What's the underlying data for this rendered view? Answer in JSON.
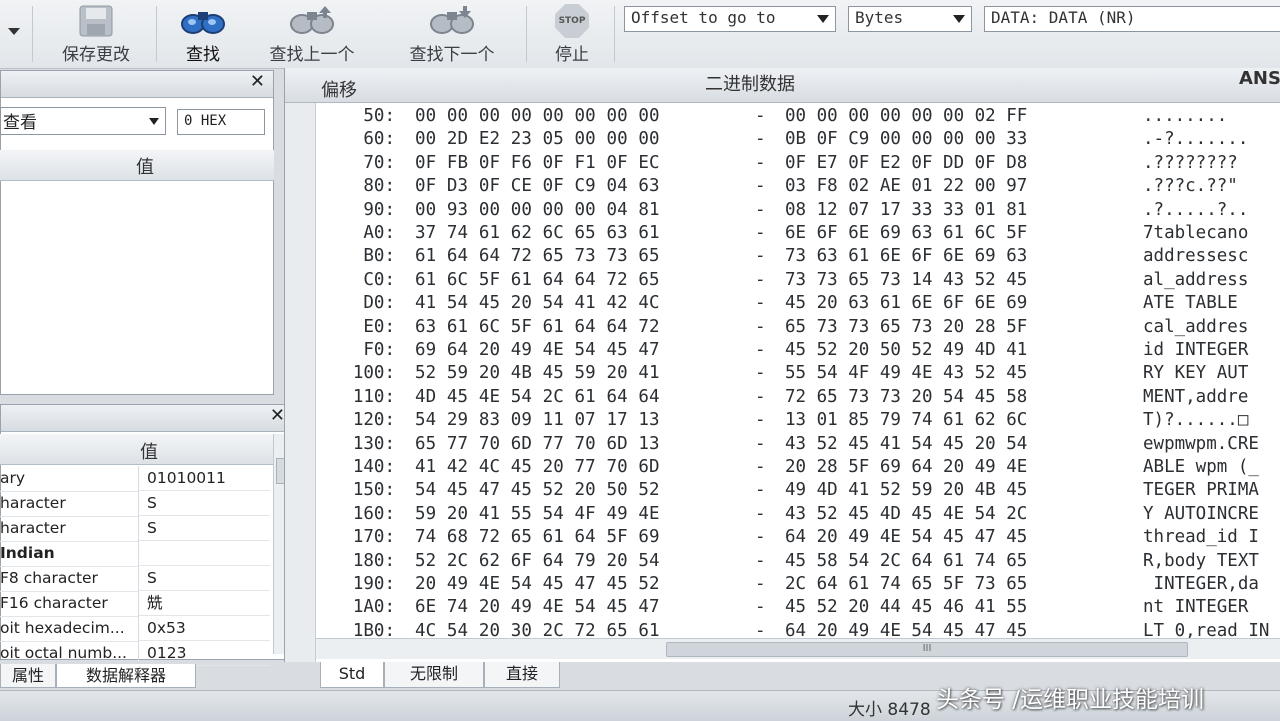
{
  "toolbar": {
    "save": "保存更改",
    "find": "查找",
    "find_prev": "查找上一个",
    "find_next": "查找下一个",
    "stop": "停止",
    "stop_icon_text": "STOP",
    "offset_combo": "Offset to go to",
    "unit_combo": "Bytes",
    "data_field": "DATA: DATA (NR)"
  },
  "left_top": {
    "view_select": "查看",
    "hex_field": "0 HEX",
    "value_header": "值"
  },
  "left_bottom": {
    "value_header": "值",
    "rows": [
      {
        "name": "ary",
        "value": "01010011"
      },
      {
        "name": "haracter",
        "value": "S"
      },
      {
        "name": "haracter",
        "value": "S"
      },
      {
        "name": "Indian",
        "value": ""
      },
      {
        "name": "F8 character",
        "value": "S"
      },
      {
        "name": "F16 character",
        "value": "兟"
      },
      {
        "name": "oit hexadecim...",
        "value": "0x53"
      },
      {
        "name": "oit octal numb...",
        "value": "0123"
      }
    ],
    "tabs": [
      "属性",
      "数据解释器"
    ]
  },
  "hex_view": {
    "offset_header": "偏移",
    "data_header": "二进制数据",
    "ascii_header": "ANS",
    "rows": [
      {
        "off": "50:",
        "b1": "00 00 00 00 00 00 00 00",
        "b2": "00 00 00 00 00 00 02 FF",
        "asc": "........"
      },
      {
        "off": "60:",
        "b1": "00 2D E2 23 05 00 00 00",
        "b2": "0B 0F C9 00 00 00 00 33",
        "asc": ".-?......."
      },
      {
        "off": "70:",
        "b1": "0F FB 0F F6 0F F1 0F EC",
        "b2": "0F E7 0F E2 0F DD 0F D8",
        "asc": ".????????"
      },
      {
        "off": "80:",
        "b1": "0F D3 0F CE 0F C9 04 63",
        "b2": "03 F8 02 AE 01 22 00 97",
        "asc": ".???c.??\""
      },
      {
        "off": "90:",
        "b1": "00 93 00 00 00 00 04 81",
        "b2": "08 12 07 17 33 33 01 81",
        "asc": ".?.....?.."
      },
      {
        "off": "A0:",
        "b1": "37 74 61 62 6C 65 63 61",
        "b2": "6E 6F 6E 69 63 61 6C 5F",
        "asc": "7tablecano"
      },
      {
        "off": "B0:",
        "b1": "61 64 64 72 65 73 73 65",
        "b2": "73 63 61 6E 6F 6E 69 63",
        "asc": "addressesc"
      },
      {
        "off": "C0:",
        "b1": "61 6C 5F 61 64 64 72 65",
        "b2": "73 73 65 73 14 43 52 45",
        "asc": "al_address"
      },
      {
        "off": "D0:",
        "b1": "41 54 45 20 54 41 42 4C",
        "b2": "45 20 63 61 6E 6F 6E 69",
        "asc": "ATE TABLE "
      },
      {
        "off": "E0:",
        "b1": "63 61 6C 5F 61 64 64 72",
        "b2": "65 73 73 65 73 20 28 5F",
        "asc": "cal_addres"
      },
      {
        "off": "F0:",
        "b1": "69 64 20 49 4E 54 45 47",
        "b2": "45 52 20 50 52 49 4D 41",
        "asc": "id INTEGER"
      },
      {
        "off": "100:",
        "b1": "52 59 20 4B 45 59 20 41",
        "b2": "55 54 4F 49 4E 43 52 45",
        "asc": "RY KEY AUT"
      },
      {
        "off": "110:",
        "b1": "4D 45 4E 54 2C 61 64 64",
        "b2": "72 65 73 73 20 54 45 58",
        "asc": "MENT,addre"
      },
      {
        "off": "120:",
        "b1": "54 29 83 09 11 07 17 13",
        "b2": "13 01 85 79 74 61 62 6C",
        "asc": "T)?......□"
      },
      {
        "off": "130:",
        "b1": "65 77 70 6D 77 70 6D 13",
        "b2": "43 52 45 41 54 45 20 54",
        "asc": "ewpmwpm.CRE"
      },
      {
        "off": "140:",
        "b1": "41 42 4C 45 20 77 70 6D",
        "b2": "20 28 5F 69 64 20 49 4E",
        "asc": "ABLE wpm (_"
      },
      {
        "off": "150:",
        "b1": "54 45 47 45 52 20 50 52",
        "b2": "49 4D 41 52 59 20 4B 45",
        "asc": "TEGER PRIMA"
      },
      {
        "off": "160:",
        "b1": "59 20 41 55 54 4F 49 4E",
        "b2": "43 52 45 4D 45 4E 54 2C",
        "asc": "Y AUTOINCRE"
      },
      {
        "off": "170:",
        "b1": "74 68 72 65 61 64 5F 69",
        "b2": "64 20 49 4E 54 45 47 45",
        "asc": "thread_id I"
      },
      {
        "off": "180:",
        "b1": "52 2C 62 6F 64 79 20 54",
        "b2": "45 58 54 2C 64 61 74 65",
        "asc": "R,body TEXT"
      },
      {
        "off": "190:",
        "b1": "20 49 4E 54 45 47 45 52",
        "b2": "2C 64 61 74 65 5F 73 65",
        "asc": " INTEGER,da"
      },
      {
        "off": "1A0:",
        "b1": "6E 74 20 49 4E 54 45 47",
        "b2": "45 52 20 44 45 46 41 55",
        "asc": "nt INTEGER "
      },
      {
        "off": "1B0:",
        "b1": "4C 54 20 30 2C 72 65 61",
        "b2": "64 20 49 4E 54 45 47 45",
        "asc": "LT 0,read IN"
      }
    ],
    "tabs": [
      "Std",
      "无限制",
      "直接"
    ],
    "scroll_grip": "III"
  },
  "status": {
    "size": "大小 8478"
  },
  "watermark": "头条号 /运维职业技能培训"
}
